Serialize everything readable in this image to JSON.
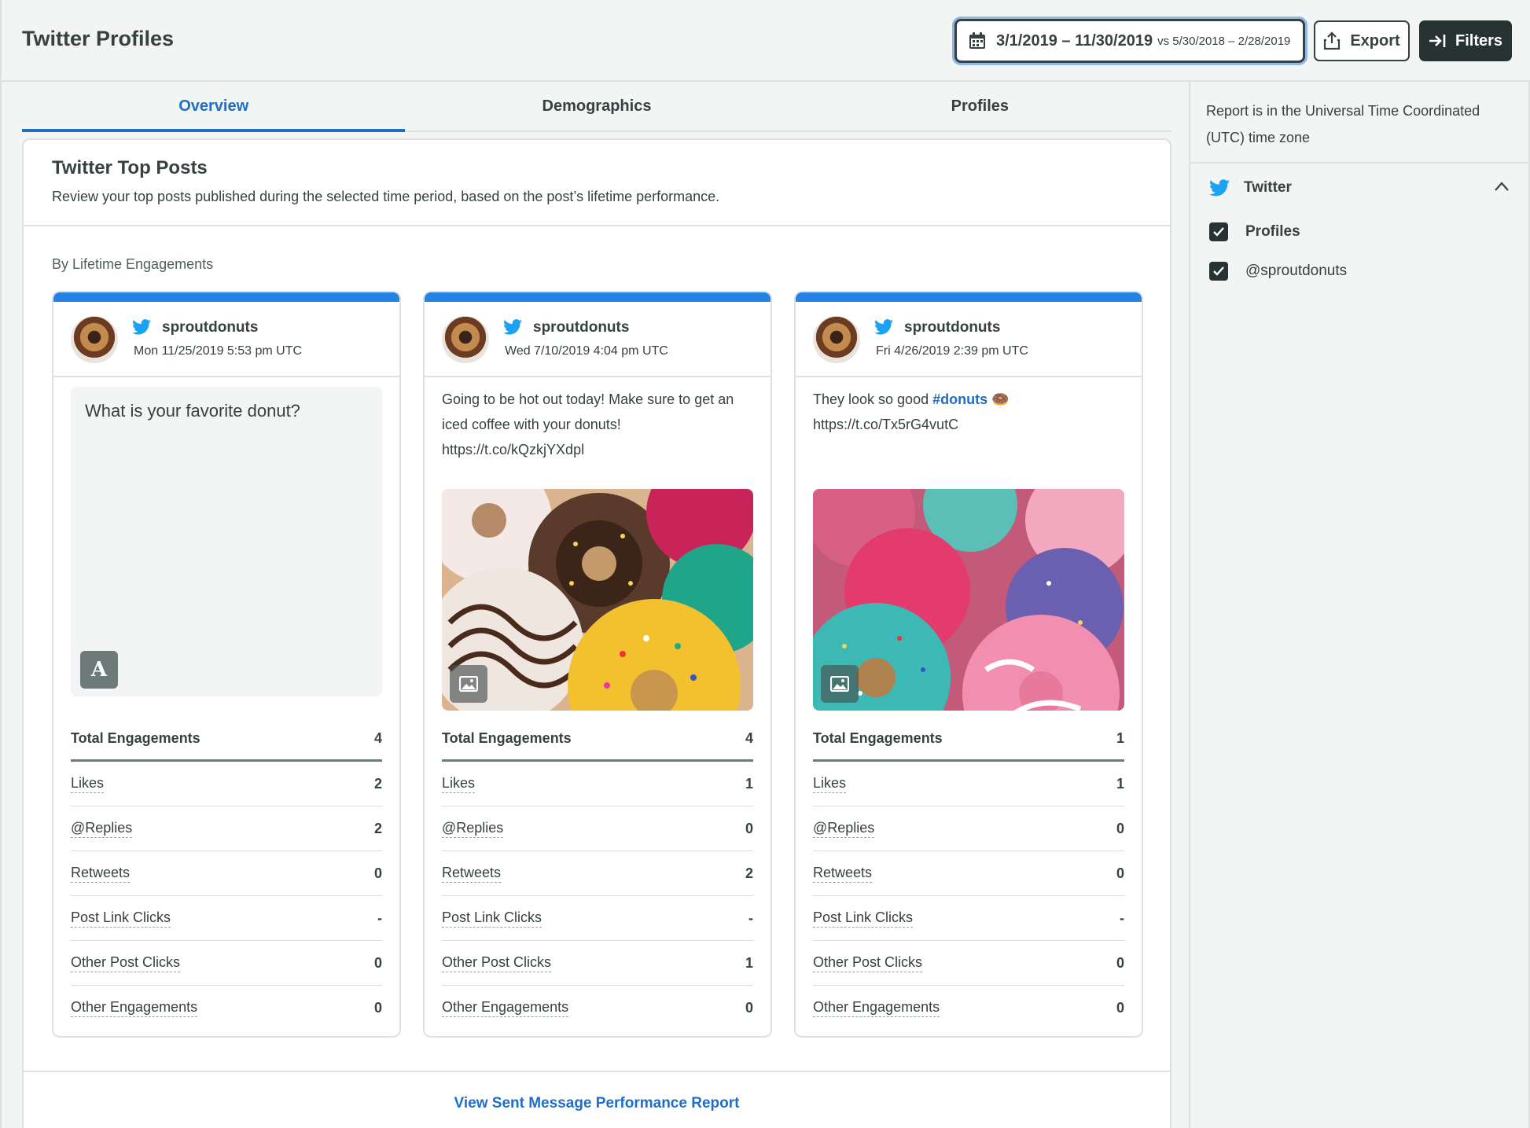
{
  "header": {
    "title": "Twitter Profiles",
    "date_range": "3/1/2019 – 11/30/2019",
    "compare_range": "vs 5/30/2018 – 2/28/2019",
    "export_label": "Export",
    "filters_label": "Filters"
  },
  "tabs": [
    {
      "label": "Overview",
      "active": true
    },
    {
      "label": "Demographics",
      "active": false
    },
    {
      "label": "Profiles",
      "active": false
    }
  ],
  "panel": {
    "title": "Twitter Top Posts",
    "subtitle": "Review your top posts published during the selected time period, based on the post’s lifetime performance.",
    "section_label": "By Lifetime Engagements",
    "footer_link": "View Sent Message Performance Report"
  },
  "metric_labels": [
    "Total Engagements",
    "Likes",
    "@Replies",
    "Retweets",
    "Post Link Clicks",
    "Other Post Clicks",
    "Other Engagements"
  ],
  "posts": [
    {
      "user": "sproutdonuts",
      "date": "Mon 11/25/2019 5:53 pm UTC",
      "text": "What is your favorite donut?",
      "type": "text",
      "badge": "A",
      "values": [
        "4",
        "2",
        "2",
        "0",
        "-",
        "0",
        "0"
      ]
    },
    {
      "user": "sproutdonuts",
      "date": "Wed 7/10/2019 4:04 pm UTC",
      "text": "Going to be hot out today! Make sure to get an iced coffee with your donuts! https://t.co/kQzkjYXdpl",
      "type": "image",
      "values": [
        "4",
        "1",
        "0",
        "2",
        "-",
        "1",
        "0"
      ]
    },
    {
      "user": "sproutdonuts",
      "date": "Fri 4/26/2019 2:39 pm UTC",
      "text_before": "They look so good ",
      "hashtag": "#donuts",
      "text_after": " 🍩 https://t.co/Tx5rG4vutC",
      "type": "image",
      "values": [
        "1",
        "1",
        "0",
        "0",
        "-",
        "0",
        "0"
      ]
    }
  ],
  "sidebar": {
    "tz_note": "Report is in the Universal Time Coordinated (UTC) time zone",
    "network": "Twitter",
    "checks": [
      {
        "label": "Profiles",
        "checked": true
      },
      {
        "label": "@sproutdonuts",
        "checked": true
      }
    ]
  },
  "colors": {
    "accent": "#1e6ec8",
    "twitter_blue": "#1da1f2",
    "card_topbar": "#2483e2",
    "dark_button": "#273333"
  },
  "icons": [
    "calendar-icon",
    "export-icon",
    "filters-icon",
    "twitter-icon",
    "image-icon",
    "chevron-up-icon",
    "check-icon"
  ]
}
